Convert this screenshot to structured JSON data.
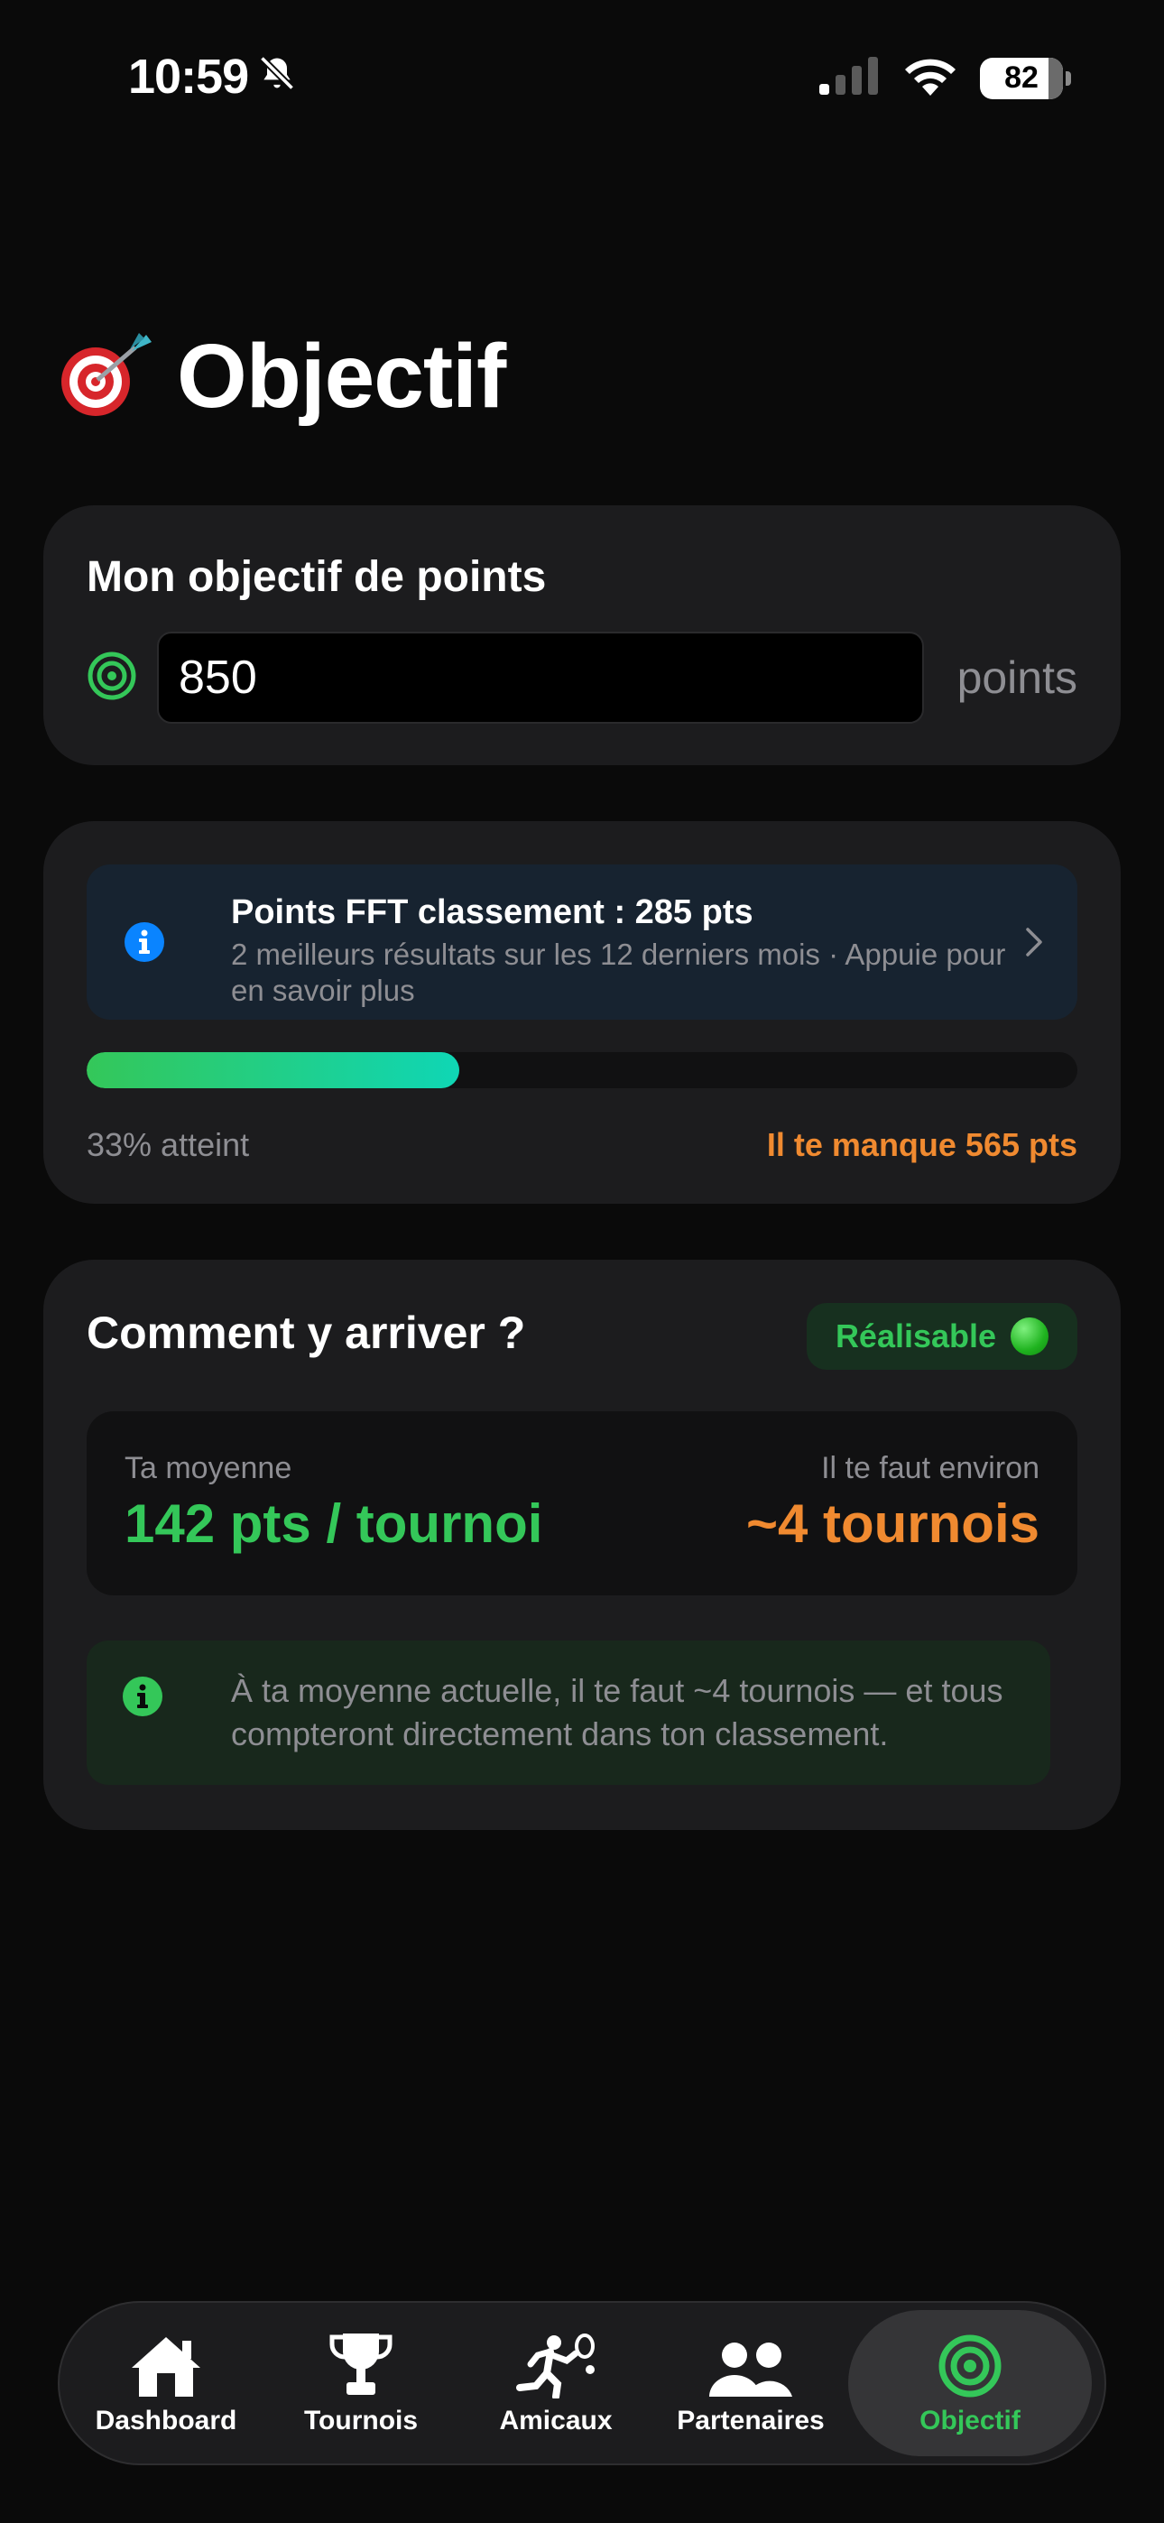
{
  "status_bar": {
    "time": "10:59",
    "battery": "82",
    "mute_icon": "bell-slash-icon",
    "signal_icon": "cellular-signal-icon",
    "wifi_icon": "wifi-icon"
  },
  "page": {
    "title": "Objectif",
    "title_icon": "dart-target-emoji"
  },
  "goal": {
    "title": "Mon objectif de points",
    "value": "850",
    "unit": "points"
  },
  "progress": {
    "info_title": "Points FFT classement : 285 pts",
    "info_subtitle": "2 meilleurs résultats sur les 12 derniers mois · Appuie pour en savoir plus",
    "percent": 33,
    "percent_label": "33% atteint",
    "missing_label": "Il te manque 565 pts"
  },
  "how": {
    "title": "Comment y arriver ?",
    "badge": "Réalisable",
    "avg_label": "Ta moyenne",
    "avg_value": "142 pts / tournoi",
    "need_label": "Il te faut environ",
    "need_value": "~4 tournois",
    "note": "À ta moyenne actuelle, il te faut ~4 tournois — et tous compteront directement dans ton classement."
  },
  "tabs": [
    {
      "label": "Dashboard",
      "icon": "house-icon",
      "active": false
    },
    {
      "label": "Tournois",
      "icon": "trophy-icon",
      "active": false
    },
    {
      "label": "Amicaux",
      "icon": "runner-racket-icon",
      "active": false
    },
    {
      "label": "Partenaires",
      "icon": "people-icon",
      "active": false
    },
    {
      "label": "Objectif",
      "icon": "target-icon",
      "active": true
    }
  ],
  "colors": {
    "accent_green": "#34c759",
    "accent_orange": "#f08a30",
    "info_blue": "#0a84ff",
    "background": "#0a0a0a",
    "card": "#1c1c1e"
  }
}
